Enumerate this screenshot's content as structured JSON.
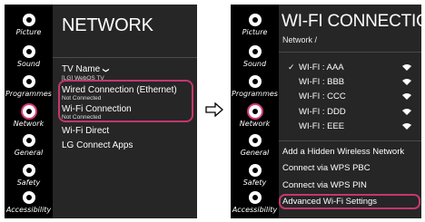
{
  "sidebar": {
    "items": [
      {
        "label": "Picture",
        "icon": "picture-icon"
      },
      {
        "label": "Sound",
        "icon": "sound-icon"
      },
      {
        "label": "Programmes",
        "icon": "programmes-icon"
      },
      {
        "label": "Network",
        "icon": "network-icon"
      },
      {
        "label": "General",
        "icon": "general-icon"
      },
      {
        "label": "Safety",
        "icon": "safety-icon"
      },
      {
        "label": "Accessibility",
        "icon": "accessibility-icon"
      }
    ],
    "active": "Network"
  },
  "network": {
    "title": "NETWORK",
    "tv_name": "TV Name",
    "tv_name_chevron": "❯",
    "tv_name_value": "[LG] WebOS TV",
    "wired": {
      "label": "Wired Connection (Ethernet)",
      "status": "Not Connected"
    },
    "wifi": {
      "label": "Wi-Fi Connection",
      "status": "Not Connected"
    },
    "wifi_direct": "Wi-Fi Direct",
    "lg_connect": "LG Connect Apps"
  },
  "wifi_connection": {
    "title": "WI-FI CONNECTION",
    "breadcrumb": "Network /",
    "networks": [
      {
        "name": "WI-FI : AAA",
        "selected": true
      },
      {
        "name": "WI-FI : BBB",
        "selected": false
      },
      {
        "name": "WI-FI : CCC",
        "selected": false
      },
      {
        "name": "WI-FI : DDD",
        "selected": false
      },
      {
        "name": "WI-FI : EEE",
        "selected": false
      }
    ],
    "check_mark": "✓",
    "add_hidden": "Add a Hidden Wireless Network",
    "wps_pbc": "Connect via WPS PBC",
    "wps_pin": "Connect via WPS PIN",
    "advanced": "Advanced Wi-Fi Settings"
  },
  "colors": {
    "highlight": "#c4376d",
    "panel": "#262626",
    "sidebar": "#000000"
  }
}
